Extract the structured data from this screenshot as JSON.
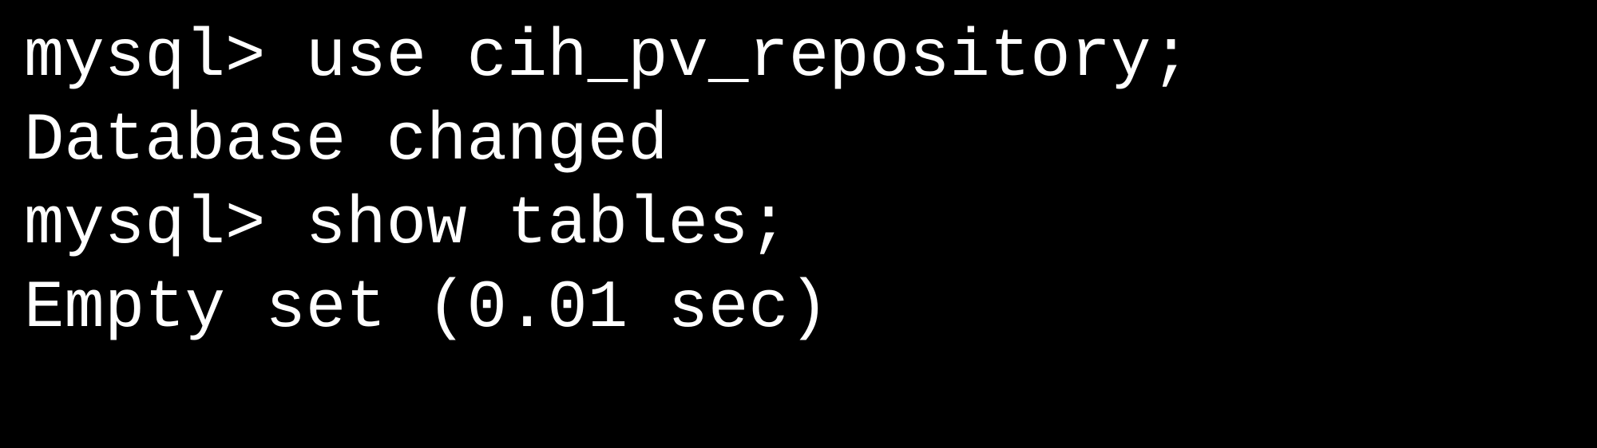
{
  "terminal": {
    "lines": [
      {
        "prompt": "mysql> ",
        "command": "use cih_pv_repository;",
        "type": "input"
      },
      {
        "output": "Database changed",
        "type": "output"
      },
      {
        "prompt": "mysql> ",
        "command": "show tables;",
        "type": "input"
      },
      {
        "output": "Empty set (0.01 sec)",
        "type": "output"
      }
    ]
  }
}
